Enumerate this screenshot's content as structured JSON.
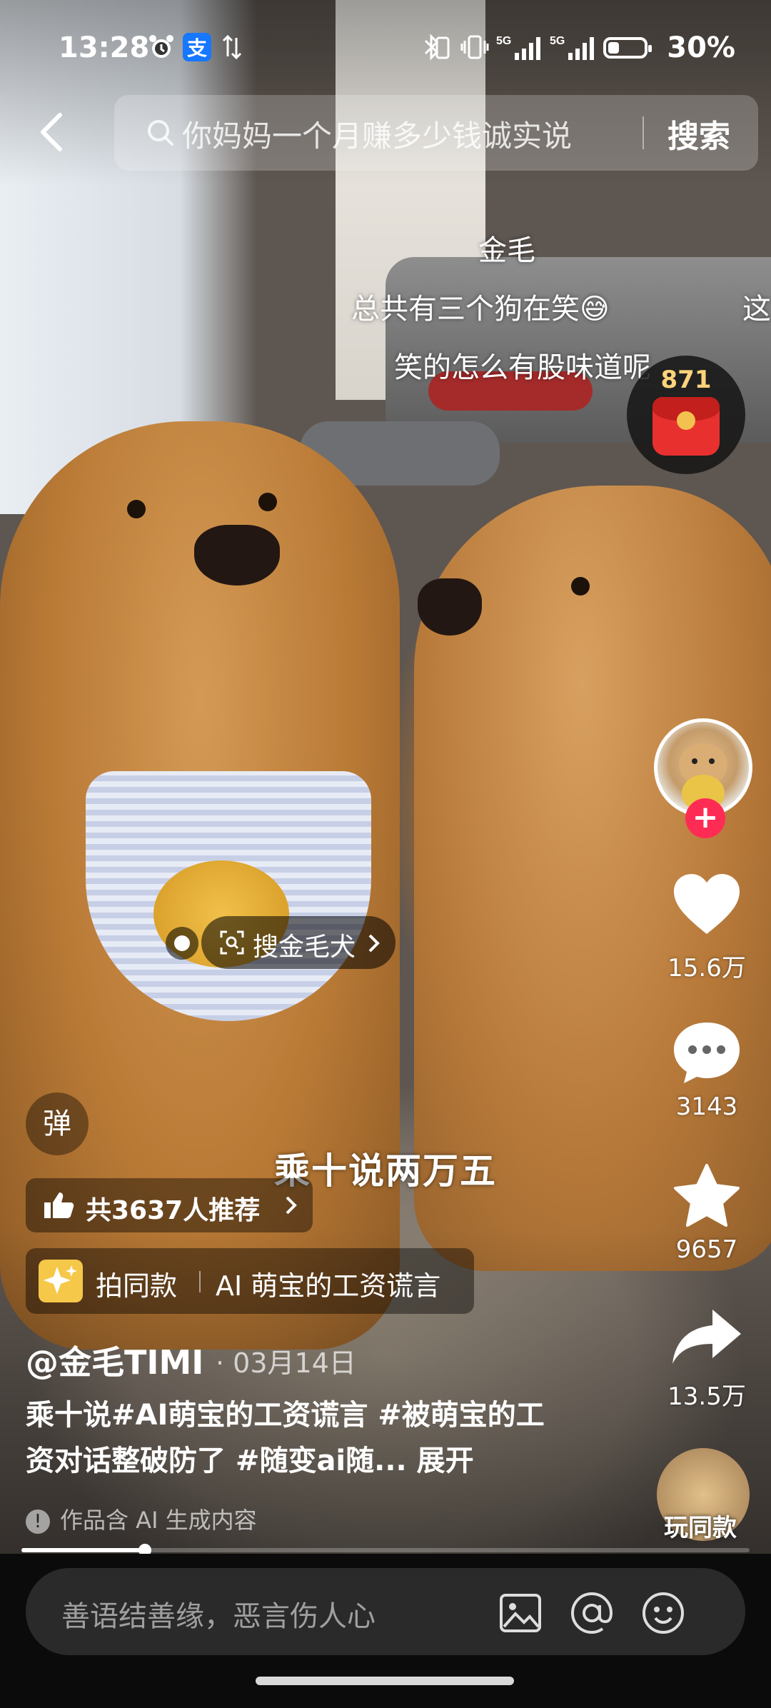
{
  "status_bar": {
    "time": "13:28",
    "battery": "30%",
    "battery_level": 0.3,
    "network1": "5G",
    "network2": "5G",
    "alipay_glyph": "支"
  },
  "search": {
    "query": "你妈妈一个月赚多少钱诚实说",
    "button_label": "搜索"
  },
  "danmaku": [
    "金毛",
    "总共有三个狗在笑😅",
    "这",
    "笑的怎么有股味道呢"
  ],
  "red_packet": {
    "count": "871"
  },
  "actions": {
    "likes": "15.6万",
    "comments": "3143",
    "favorites": "9657",
    "shares": "13.5万",
    "play_same": "玩同款"
  },
  "search_pill": "搜金毛犬",
  "danmu_toggle": "弹",
  "subtitle": "乘十说两万五",
  "recommend": "共3637人推荐",
  "same_style": {
    "label": "拍同款",
    "title": "AI 萌宝的工资谎言"
  },
  "author": "@金毛TIMI",
  "date": "03月14日",
  "caption": {
    "text": "乘十说#AI萌宝的工资谎言 #被萌宝的工资对话整破防了 #随变ai随...",
    "expand": "展开"
  },
  "ai_notice": "作品含 AI 生成内容",
  "progress": 0.17,
  "comment": {
    "placeholder": "善语结善缘，恶言伤人心"
  },
  "icons": [
    "back-icon",
    "search-icon",
    "heart-icon",
    "comment-icon",
    "star-icon",
    "share-icon",
    "image-icon",
    "at-icon",
    "emoji-icon",
    "thumbs-up-icon",
    "sparkle-icon",
    "scan-icon",
    "chevron-right-icon",
    "alarm-icon",
    "bluetooth-icon",
    "vibrate-icon",
    "signal-icon"
  ],
  "colors": {
    "accent_red": "#fe2c55",
    "same_style_icon": "#f6c84a",
    "red_packet": "#e8312f"
  }
}
